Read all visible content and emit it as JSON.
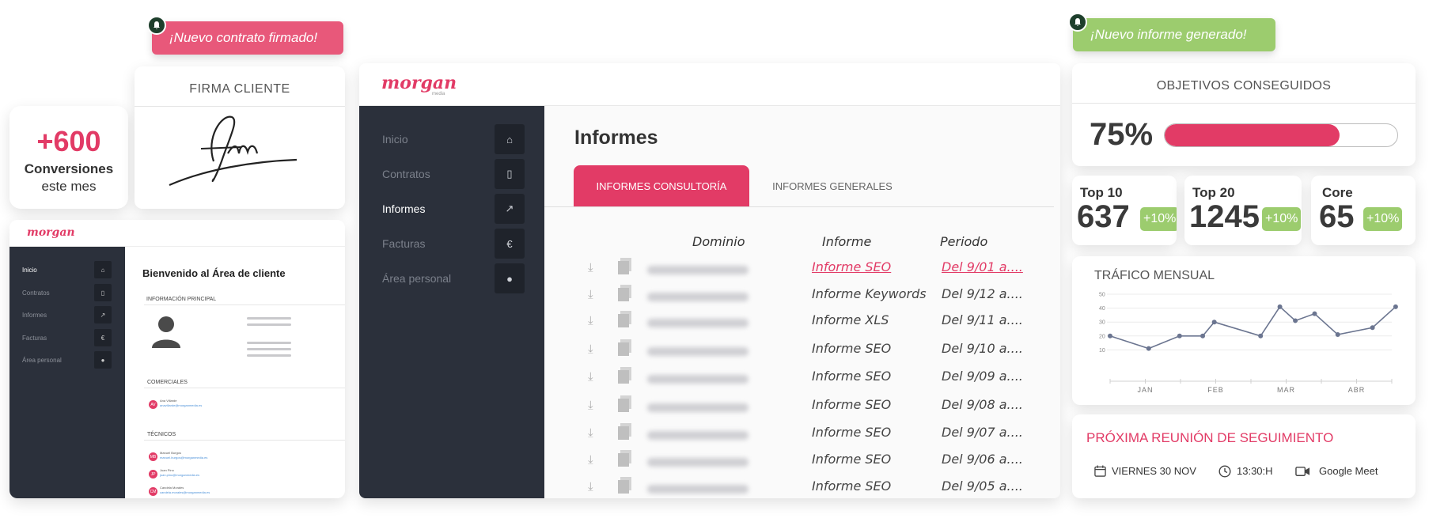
{
  "notifications": {
    "contract": "¡Nuevo contrato firmado!",
    "report": "¡Nuevo informe generado!"
  },
  "conversions": {
    "value": "+600",
    "label": "Conversiones",
    "sublabel": "este mes"
  },
  "signature": {
    "title": "FIRMA CLIENTE"
  },
  "brand": {
    "name": "morgan",
    "tagline": "media",
    "color": "#e23b66"
  },
  "mini_dashboard": {
    "welcome": "Bienvenido al Área de cliente",
    "section_main": "INFORMACIÓN PRINCIPAL",
    "section_sales": "COMERCIALES",
    "section_tech": "TÉCNICOS",
    "nav": [
      {
        "label": "Inicio",
        "icon": "home-icon"
      },
      {
        "label": "Contratos",
        "icon": "file-pdf-icon"
      },
      {
        "label": "Informes",
        "icon": "chart-line-icon"
      },
      {
        "label": "Facturas",
        "icon": "euro-icon"
      },
      {
        "label": "Área personal",
        "icon": "user-icon"
      }
    ],
    "sales_contacts": [
      {
        "name": "Ana Villarde",
        "email": "anavillarde@morganmedia.es"
      }
    ],
    "tech_contacts": [
      {
        "name": "Manuel Burgos",
        "email": "manuel.burgos@morganmedia.es"
      },
      {
        "name": "Juan Pino",
        "email": "juan.pino@morganmedia.es"
      },
      {
        "name": "Candela Morales",
        "email": "candela.morales@morganmedia.es"
      }
    ]
  },
  "main_dashboard": {
    "page_title": "Informes",
    "nav": [
      {
        "label": "Inicio",
        "icon": "home-icon",
        "active": false
      },
      {
        "label": "Contratos",
        "icon": "file-pdf-icon",
        "active": false
      },
      {
        "label": "Informes",
        "icon": "chart-line-icon",
        "active": true
      },
      {
        "label": "Facturas",
        "icon": "euro-icon",
        "active": false
      },
      {
        "label": "Área personal",
        "icon": "user-icon",
        "active": false
      }
    ],
    "tabs": [
      {
        "label": "INFORMES CONSULTORÍA",
        "active": true
      },
      {
        "label": "INFORMES GENERALES",
        "active": false
      }
    ],
    "columns": [
      "Dominio",
      "Informe",
      "Periodo"
    ],
    "rows": [
      {
        "report": "Informe SEO",
        "period": "Del 9/01 a...."
      },
      {
        "report": "Informe Keywords",
        "period": "Del 9/12 a...."
      },
      {
        "report": "Informe XLS",
        "period": "Del 9/11 a...."
      },
      {
        "report": "Informe SEO",
        "period": "Del 9/10 a...."
      },
      {
        "report": "Informe SEO",
        "period": "Del 9/09 a...."
      },
      {
        "report": "Informe SEO",
        "period": "Del 9/08 a...."
      },
      {
        "report": "Informe SEO",
        "period": "Del 9/07 a...."
      },
      {
        "report": "Informe SEO",
        "period": "Del 9/06 a...."
      },
      {
        "report": "Informe SEO",
        "period": "Del 9/05 a...."
      }
    ]
  },
  "objectives": {
    "title": "OBJETIVOS CONSEGUIDOS",
    "percent_label": "75%",
    "progress": 0.75
  },
  "stats": [
    {
      "label": "Top 10",
      "value": "637",
      "delta": "+10%"
    },
    {
      "label": "Top 20",
      "value": "1245",
      "delta": "+10%"
    },
    {
      "label": "Core",
      "value": "65",
      "delta": "+10%"
    }
  ],
  "traffic": {
    "title": "TRÁFICO MENSUAL"
  },
  "chart_data": {
    "type": "line",
    "title": "TRÁFICO MENSUAL",
    "categories": [
      "JAN",
      "FEB",
      "MAR",
      "ABR"
    ],
    "yticks": [
      "50",
      "40",
      "30",
      "20",
      "10"
    ],
    "ylim": [
      0,
      50
    ],
    "grid": true,
    "series": [
      {
        "x": [
          0.0,
          0.5,
          0.9,
          1.2,
          1.35,
          1.95,
          2.2,
          2.4,
          2.65,
          2.95,
          3.4,
          3.7
        ],
        "values": [
          20,
          11,
          20,
          20,
          30,
          20,
          41,
          31,
          36,
          21,
          26,
          41
        ]
      }
    ],
    "color": "#6b7590"
  },
  "meeting": {
    "title": "PRÓXIMA REUNIÓN DE SEGUIMIENTO",
    "date": "VIERNES 30 NOV",
    "time": "13:30:H",
    "platform": "Google Meet"
  }
}
